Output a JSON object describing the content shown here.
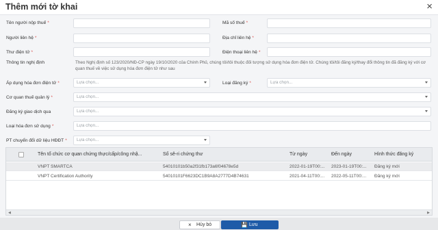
{
  "dialog": {
    "title": "Thêm mới tờ khai",
    "close_glyph": "×"
  },
  "form": {
    "taxpayer_name_label": "Tên người nộp thuế",
    "tax_code_label": "Mã số thuế",
    "contact_person_label": "Người liên hệ",
    "contact_address_label": "Địa chỉ liên hệ",
    "email_label": "Thư điện tử",
    "phone_label": "Điện thoại liên hệ",
    "decree_info_label": "Thông tin nghị định",
    "decree_info_text": "Theo Nghị định số 123/2020/NĐ-CP ngày 19/10/2020 của Chính Phủ, chúng tôi/tôi thuộc đối tượng sử dụng hóa đơn điện tử. Chúng tôi/tôi đăng ký/thay đổi thông tin đã đăng ký với cơ quan thuế về việc sử dụng hóa đơn điện tử như sau",
    "apply_einvoice_label": "Áp dụng hóa đơn điện tử",
    "registration_type_label": "Loại đăng ký",
    "tax_authority_label": "Cơ quan thuế quản lý",
    "transaction_register_label": "Đăng ký giao dịch qua",
    "invoice_type_label": "Loại hóa đơn sử dụng",
    "conversion_method_label": "PT chuyển đổi dữ liệu HĐĐT",
    "select_placeholder": "Lựa chọn...",
    "required_mark": "*"
  },
  "table": {
    "headers": [
      "Tên tổ chức cơ quan chứng thực/cấp/công nhậ...",
      "Số sê-ri chứng thư",
      "Từ ngày",
      "Đến ngày",
      "Hình thức đăng ký"
    ],
    "rows": [
      [
        "VNPT SMARTCA",
        "54010101b50a2f31fb173a6f04678e5d",
        "2022-01-19T00:...",
        "2023-01-19T00:...",
        "Đăng ký mới"
      ],
      [
        "VNPT Certification Authority",
        "54010101F6623DC1B9A8A2777D4B74631",
        "2021-04-11T00:...",
        "2022-05-11T00:...",
        "Đăng ký mới"
      ]
    ]
  },
  "footer": {
    "cancel_label": "Hủy bỏ",
    "save_label": "Lưu",
    "cancel_icon": "×",
    "save_icon": "💾"
  }
}
